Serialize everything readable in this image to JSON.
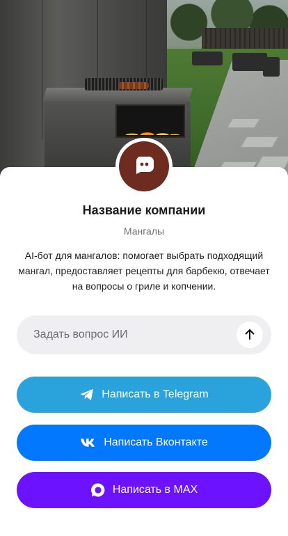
{
  "company": {
    "name": "Название компании",
    "category": "Мангалы",
    "description": "AI-бот для мангалов: помогает выбрать подходящий мангал, предоставляет рецепты для барбекю, отвечает на вопросы о гриле и копчении."
  },
  "ask": {
    "placeholder": "Задать вопрос ИИ",
    "value": ""
  },
  "actions": {
    "telegram": {
      "label": "Написать в Telegram",
      "icon": "telegram-icon",
      "color": "#2aa3dd"
    },
    "vk": {
      "label": "Написать Вконтакте",
      "icon": "vk-icon",
      "color": "#0277ff"
    },
    "max": {
      "label": "Написать в MAX",
      "icon": "max-icon",
      "color": "#6c12ff"
    }
  },
  "colors": {
    "avatar_bg": "#6e2b20",
    "input_bg": "#efeff1",
    "text": "#1b1b1d",
    "muted": "#6f6f74"
  },
  "icons": {
    "avatar": "chat-bot-icon",
    "send": "arrow-up-icon"
  }
}
